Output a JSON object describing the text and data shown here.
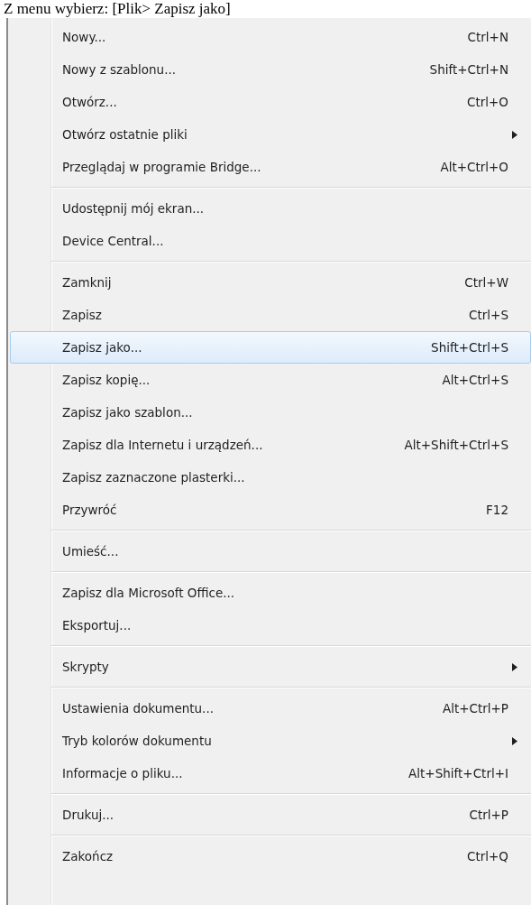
{
  "caption": "Z menu wybierz: [Plik> Zapisz jako]",
  "menu": {
    "items": [
      {
        "kind": "item",
        "label": "Nowy...",
        "shortcut": "Ctrl+N",
        "submenu": false,
        "selected": false
      },
      {
        "kind": "item",
        "label": "Nowy z szablonu...",
        "shortcut": "Shift+Ctrl+N",
        "submenu": false,
        "selected": false
      },
      {
        "kind": "item",
        "label": "Otwórz...",
        "shortcut": "Ctrl+O",
        "submenu": false,
        "selected": false
      },
      {
        "kind": "item",
        "label": "Otwórz ostatnie pliki",
        "submenu": true,
        "selected": false
      },
      {
        "kind": "item",
        "label": "Przeglądaj w programie Bridge...",
        "shortcut": "Alt+Ctrl+O",
        "submenu": false,
        "selected": false
      },
      {
        "kind": "separator"
      },
      {
        "kind": "item",
        "label": "Udostępnij mój ekran...",
        "submenu": false,
        "selected": false
      },
      {
        "kind": "item",
        "label": "Device Central...",
        "submenu": false,
        "selected": false
      },
      {
        "kind": "separator"
      },
      {
        "kind": "item",
        "label": "Zamknij",
        "shortcut": "Ctrl+W",
        "submenu": false,
        "selected": false
      },
      {
        "kind": "item",
        "label": "Zapisz",
        "shortcut": "Ctrl+S",
        "submenu": false,
        "selected": false
      },
      {
        "kind": "item",
        "label": "Zapisz jako...",
        "shortcut": "Shift+Ctrl+S",
        "submenu": false,
        "selected": true
      },
      {
        "kind": "item",
        "label": "Zapisz kopię...",
        "shortcut": "Alt+Ctrl+S",
        "submenu": false,
        "selected": false
      },
      {
        "kind": "item",
        "label": "Zapisz jako szablon...",
        "submenu": false,
        "selected": false
      },
      {
        "kind": "item",
        "label": "Zapisz dla Internetu i urządzeń...",
        "shortcut": "Alt+Shift+Ctrl+S",
        "submenu": false,
        "selected": false
      },
      {
        "kind": "item",
        "label": "Zapisz zaznaczone plasterki...",
        "submenu": false,
        "selected": false
      },
      {
        "kind": "item",
        "label": "Przywróć",
        "shortcut": "F12",
        "submenu": false,
        "selected": false
      },
      {
        "kind": "separator"
      },
      {
        "kind": "item",
        "label": "Umieść...",
        "submenu": false,
        "selected": false
      },
      {
        "kind": "separator"
      },
      {
        "kind": "item",
        "label": "Zapisz dla Microsoft Office...",
        "submenu": false,
        "selected": false
      },
      {
        "kind": "item",
        "label": "Eksportuj...",
        "submenu": false,
        "selected": false
      },
      {
        "kind": "separator"
      },
      {
        "kind": "item",
        "label": "Skrypty",
        "submenu": true,
        "selected": false
      },
      {
        "kind": "separator"
      },
      {
        "kind": "item",
        "label": "Ustawienia dokumentu...",
        "shortcut": "Alt+Ctrl+P",
        "submenu": false,
        "selected": false
      },
      {
        "kind": "item",
        "label": "Tryb kolorów dokumentu",
        "submenu": true,
        "selected": false
      },
      {
        "kind": "item",
        "label": "Informacje o pliku...",
        "shortcut": "Alt+Shift+Ctrl+I",
        "submenu": false,
        "selected": false
      },
      {
        "kind": "separator"
      },
      {
        "kind": "item",
        "label": "Drukuj...",
        "shortcut": "Ctrl+P",
        "submenu": false,
        "selected": false
      },
      {
        "kind": "separator"
      },
      {
        "kind": "item",
        "label": "Zakończ",
        "shortcut": "Ctrl+Q",
        "submenu": false,
        "selected": false
      }
    ]
  }
}
